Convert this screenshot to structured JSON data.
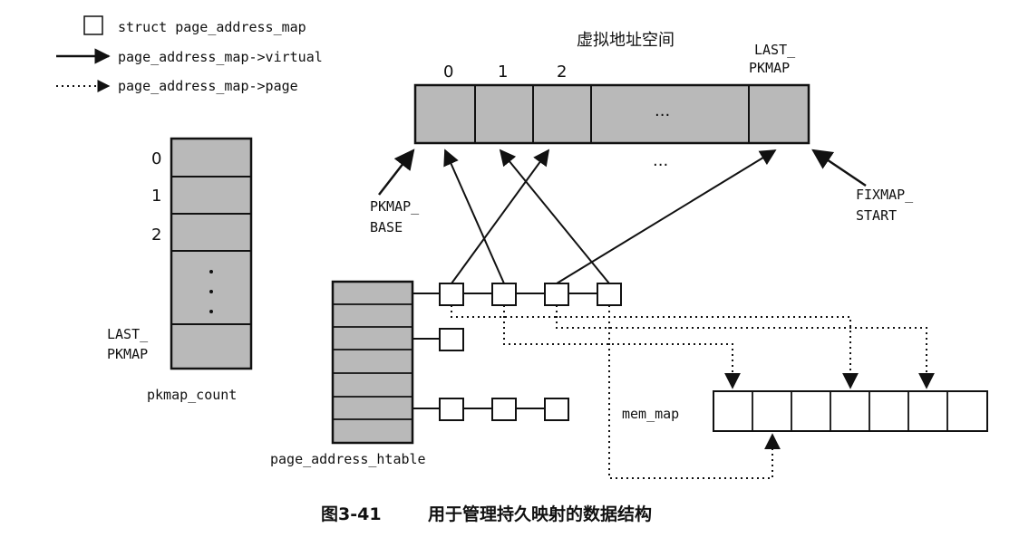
{
  "legend": {
    "struct_label": "struct page_address_map",
    "virtual_label": "page_address_map->virtual",
    "page_label": "page_address_map->page"
  },
  "virtual_space": {
    "title": "虚拟地址空间",
    "slot_labels": [
      "0",
      "1",
      "2"
    ],
    "ellipsis": "···",
    "last_label_line1": "LAST_",
    "last_label_line2": "PKMAP"
  },
  "pkmap_count": {
    "index_labels": [
      "0",
      "1",
      "2"
    ],
    "last_label_line1": "LAST_",
    "last_label_line2": "PKMAP",
    "name": "pkmap_count"
  },
  "labels": {
    "pkmap_base_line1": "PKMAP_",
    "pkmap_base_line2": "BASE",
    "fixmap_start_line1": "FIXMAP_",
    "fixmap_start_line2": "START",
    "mem_map": "mem_map",
    "htable": "page_address_htable",
    "ellipsis_below": "···"
  },
  "caption": {
    "number": "图3-41",
    "text": "用于管理持久映射的数据结构"
  },
  "colors": {
    "cell_fill": "#b9b9b9",
    "ink": "#111111",
    "empty_fill": "#ffffff"
  }
}
